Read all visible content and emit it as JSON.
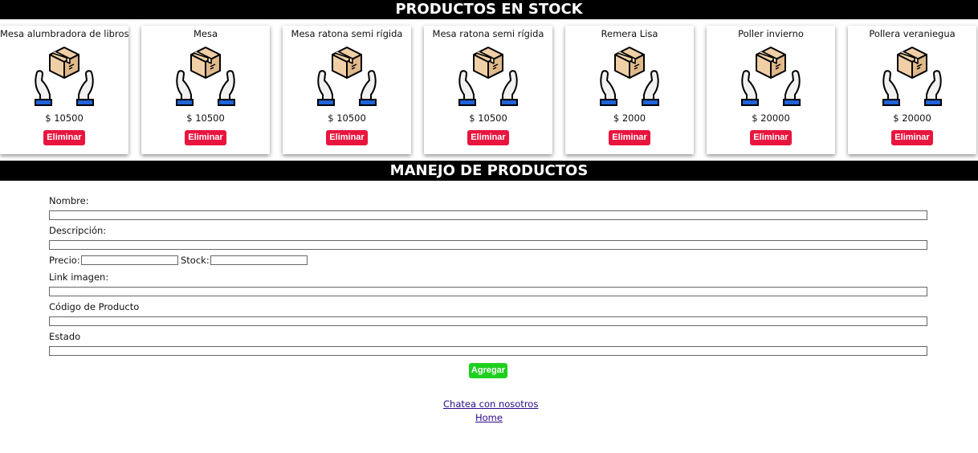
{
  "stock_header": "PRODUCTOS EN STOCK",
  "manage_header": "MANEJO DE PRODUCTOS",
  "products": [
    {
      "name": "Mesa alumbradora de libros",
      "price": "$ 10500",
      "delete_label": "Eliminar",
      "icon": "box-in-hands-icon"
    },
    {
      "name": "Mesa",
      "price": "$ 10500",
      "delete_label": "Eliminar",
      "icon": "box-in-hands-icon"
    },
    {
      "name": "Mesa ratona semi rígida",
      "price": "$ 10500",
      "delete_label": "Eliminar",
      "icon": "box-in-hands-icon"
    },
    {
      "name": "Mesa ratona semi rígida",
      "price": "$ 10500",
      "delete_label": "Eliminar",
      "icon": "box-in-hands-icon"
    },
    {
      "name": "Remera Lisa",
      "price": "$ 2000",
      "delete_label": "Eliminar",
      "icon": "box-in-hands-icon"
    },
    {
      "name": "Poller invierno",
      "price": "$ 20000",
      "delete_label": "Eliminar",
      "icon": "box-in-hands-icon"
    },
    {
      "name": "Pollera veraniegua",
      "price": "$ 20000",
      "delete_label": "Eliminar",
      "icon": "box-in-hands-icon"
    }
  ],
  "form": {
    "name_label": "Nombre:",
    "name_value": "",
    "description_label": "Descripción:",
    "description_value": "",
    "price_label": "Precio:",
    "price_value": "",
    "stock_label": "Stock:",
    "stock_value": "",
    "image_label": "Link imagen:",
    "image_value": "",
    "code_label": "Código de Producto",
    "code_value": "",
    "status_label": "Estado",
    "status_value": "",
    "add_label": "Agregar"
  },
  "footer": {
    "chat_link": "Chatea con nosotros",
    "home_link": "Home"
  },
  "colors": {
    "banner_bg": "#000000",
    "delete_button": "#e8163f",
    "add_button": "#1fd01f",
    "link": "#2a0a8a"
  }
}
